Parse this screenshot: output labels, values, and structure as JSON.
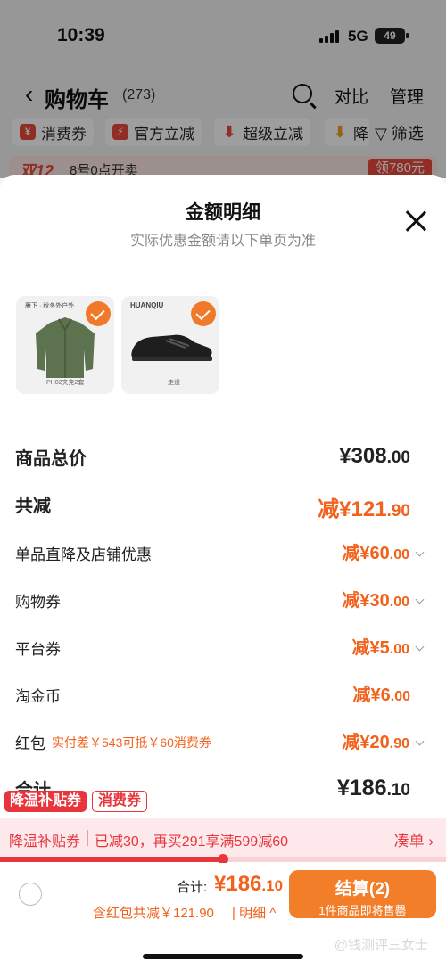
{
  "status_bar": {
    "time": "10:39",
    "network": "5G",
    "battery": "49"
  },
  "cart_header": {
    "title": "购物车",
    "count": "(273)",
    "compare": "对比",
    "manage": "管理"
  },
  "filters": {
    "chips": [
      "消费券",
      "官方立减",
      "超级立减",
      "降"
    ],
    "filter_label": "筛选"
  },
  "promo_strip": {
    "tag": "双12",
    "text": "8号0点开卖",
    "coupon": "领780元"
  },
  "sheet": {
    "title": "金额明细",
    "subtitle": "实际优惠金额请以下单页为准",
    "items": [
      {
        "name": "jacket",
        "brand": "雁下 · 秋冬外户外",
        "model": "PH02夹克2套"
      },
      {
        "name": "sneaker",
        "brand": "HUANQIU",
        "model": "走道"
      }
    ],
    "rows": {
      "subtotal": {
        "label": "商品总价",
        "amount": "¥308",
        "decimal": ".00"
      },
      "total_discount": {
        "label": "共减",
        "amount": "减¥121",
        "decimal": ".90"
      },
      "direct_discount": {
        "label": "单品直降及店铺优惠",
        "amount": "减¥60",
        "decimal": ".00"
      },
      "shopping_coupon": {
        "label": "购物券",
        "amount": "减¥30",
        "decimal": ".00"
      },
      "platform_coupon": {
        "label": "平台券",
        "amount": "减¥5",
        "decimal": ".00"
      },
      "taojinbi": {
        "label": "淘金币",
        "amount": "减¥6",
        "decimal": ".00"
      },
      "red_packet": {
        "label": "红包",
        "note": "实付差￥543可抵￥60消费券",
        "amount": "减¥20",
        "decimal": ".90"
      },
      "total": {
        "label": "合计",
        "amount": "¥186",
        "decimal": ".10"
      }
    }
  },
  "tags": {
    "red": "降温补贴券",
    "outline": "消费券"
  },
  "subsidy": {
    "title": "降温补贴券",
    "text": "已减30，再买291享满599减60",
    "link": "凑单 ›",
    "progress": 0.5
  },
  "footer": {
    "total_label": "合计:",
    "total_amount": "¥186",
    "total_decimal": ".10",
    "discount_text": "含红包共减￥121.90",
    "detail_link": "| 明细 ^",
    "checkout_label": "结算(2)",
    "checkout_sub": "1件商品即将售罄",
    "watermark": "@钱测评三女士"
  },
  "colors": {
    "accent": "#f2621c",
    "red": "#e8353c",
    "checkout": "#f27e2a"
  }
}
